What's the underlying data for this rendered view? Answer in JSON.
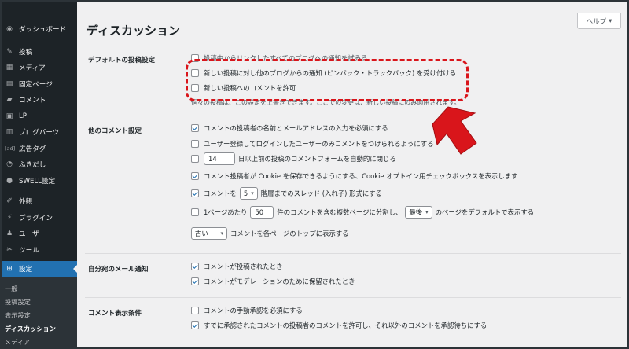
{
  "sidebar": {
    "items": [
      {
        "icon": "dashboard-icon",
        "glyph": "◉",
        "label": "ダッシュボード"
      },
      {
        "icon": "pin-icon",
        "glyph": "✎",
        "label": "投稿"
      },
      {
        "icon": "media-icon",
        "glyph": "▦",
        "label": "メディア"
      },
      {
        "icon": "page-icon",
        "glyph": "▤",
        "label": "固定ページ"
      },
      {
        "icon": "comment-icon",
        "glyph": "▰",
        "label": "コメント"
      },
      {
        "icon": "lp-icon",
        "glyph": "▣",
        "label": "LP"
      },
      {
        "icon": "blog-parts-icon",
        "glyph": "▥",
        "label": "ブログパーツ"
      },
      {
        "icon": "ad-tag-icon",
        "glyph": "[ad]",
        "label": "広告タグ"
      },
      {
        "icon": "balloon-icon",
        "glyph": "◔",
        "label": "ふきだし"
      },
      {
        "icon": "swell-icon",
        "glyph": "●",
        "label": "SWELL設定"
      },
      {
        "icon": "appearance-icon",
        "glyph": "✐",
        "label": "外観"
      },
      {
        "icon": "plugin-icon",
        "glyph": "⚡",
        "label": "プラグイン"
      },
      {
        "icon": "user-icon",
        "glyph": "♟",
        "label": "ユーザー"
      },
      {
        "icon": "tools-icon",
        "glyph": "✂",
        "label": "ツール"
      },
      {
        "icon": "settings-icon",
        "glyph": "⊞",
        "label": "設定"
      }
    ],
    "submenu": [
      "一般",
      "投稿設定",
      "表示設定",
      "ディスカッション",
      "メディア"
    ]
  },
  "help_label": "ヘルプ",
  "page_title": "ディスカッション",
  "sections": {
    "default_post": "デフォルトの投稿設定",
    "other_comments": "他のコメント設定",
    "email_me": "自分宛のメール通知",
    "before_comment": "コメント表示条件"
  },
  "default_post": {
    "notify_blogs": "投稿中からリンクしたすべてのブログへの通知を試みる",
    "allow_pingbacks": "新しい投稿に対し他のブログからの通知 (ピンバック・トラックバック) を受け付ける",
    "allow_comments": "新しい投稿へのコメントを許可",
    "note": "個々の投稿は、この設定を上書きできます。ここでの変更は、新しい投稿にのみ適用されます。"
  },
  "other_comments": {
    "require_name_email": "コメントの投稿者の名前とメールアドレスの入力を必須にする",
    "registration_required": "ユーザー登録してログインしたユーザーのみコメントをつけられるようにする",
    "close_days_value": "14",
    "close_days_label": "日以上前の投稿のコメントフォームを自動的に閉じる",
    "cookies_opt_in": "コメント投稿者が Cookie を保存できるようにする、Cookie オプトイン用チェックボックスを表示します",
    "threaded_prefix": "コメントを",
    "threaded_depth": "5",
    "threaded_suffix": "階層までのスレッド (入れ子) 形式にする",
    "paged_prefix": "1ページあたり",
    "paged_count": "50",
    "paged_middle": "件のコメントを含む複数ページに分割し、",
    "paged_select": "最後",
    "paged_suffix": "のページをデフォルトで表示する",
    "order_select": "古い",
    "order_suffix": "コメントを各ページのトップに表示する"
  },
  "email_me": {
    "anyone_posts": "コメントが投稿されたとき",
    "held_moderation": "コメントがモデレーションのために保留されたとき"
  },
  "before_comment": {
    "manual_approval": "コメントの手動承認を必須にする",
    "previously_approved": "すでに承認されたコメントの投稿者のコメントを許可し、それ以外のコメントを承認待ちにする"
  },
  "colors": {
    "sidebar_bg": "#1d2327",
    "accent": "#2271b1",
    "annotation_red": "#d9151b"
  }
}
